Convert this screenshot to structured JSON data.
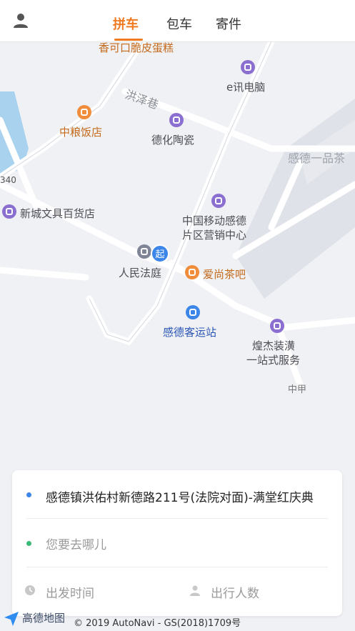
{
  "header": {
    "tabs": [
      {
        "label": "拼车",
        "active": true
      },
      {
        "label": "包车",
        "active": false
      },
      {
        "label": "寄件",
        "active": false
      }
    ],
    "user_icon": "user-icon",
    "accent_color": "#f07a21"
  },
  "map": {
    "road_labels": {
      "hongze": "洪泽巷",
      "ganxi": "感德一品茶",
      "edge_num": "340",
      "top_cut": "香可口脆皮蛋糕"
    },
    "pois": {
      "exun": "e讯电脑",
      "zhongliang": "中粮饭店",
      "dehua": "德化陶瓷",
      "xincheng": "新城文具百货店",
      "chinamobile_1": "中国移动感德",
      "chinamobile_2": "片区营销中心",
      "court": "人民法庭",
      "aishang": "爱尚茶吧",
      "station": "感德客运站",
      "huangjie_1": "煌杰装潢",
      "huangjie_2": "一站式服务",
      "zhongjia": "中甲"
    },
    "start_marker": "起"
  },
  "panel": {
    "origin": "感德镇洪佑村新德路211号(法院对面)-满堂红庆典",
    "destination_placeholder": "您要去哪儿",
    "depart_time": "出发时间",
    "passengers": "出行人数",
    "origin_dot_color": "#3b86e8",
    "dest_dot_color": "#3cb878"
  },
  "footer": {
    "logo": "高德地图",
    "copyright": "© 2019 AutoNavi - GS(2018)1709号"
  }
}
